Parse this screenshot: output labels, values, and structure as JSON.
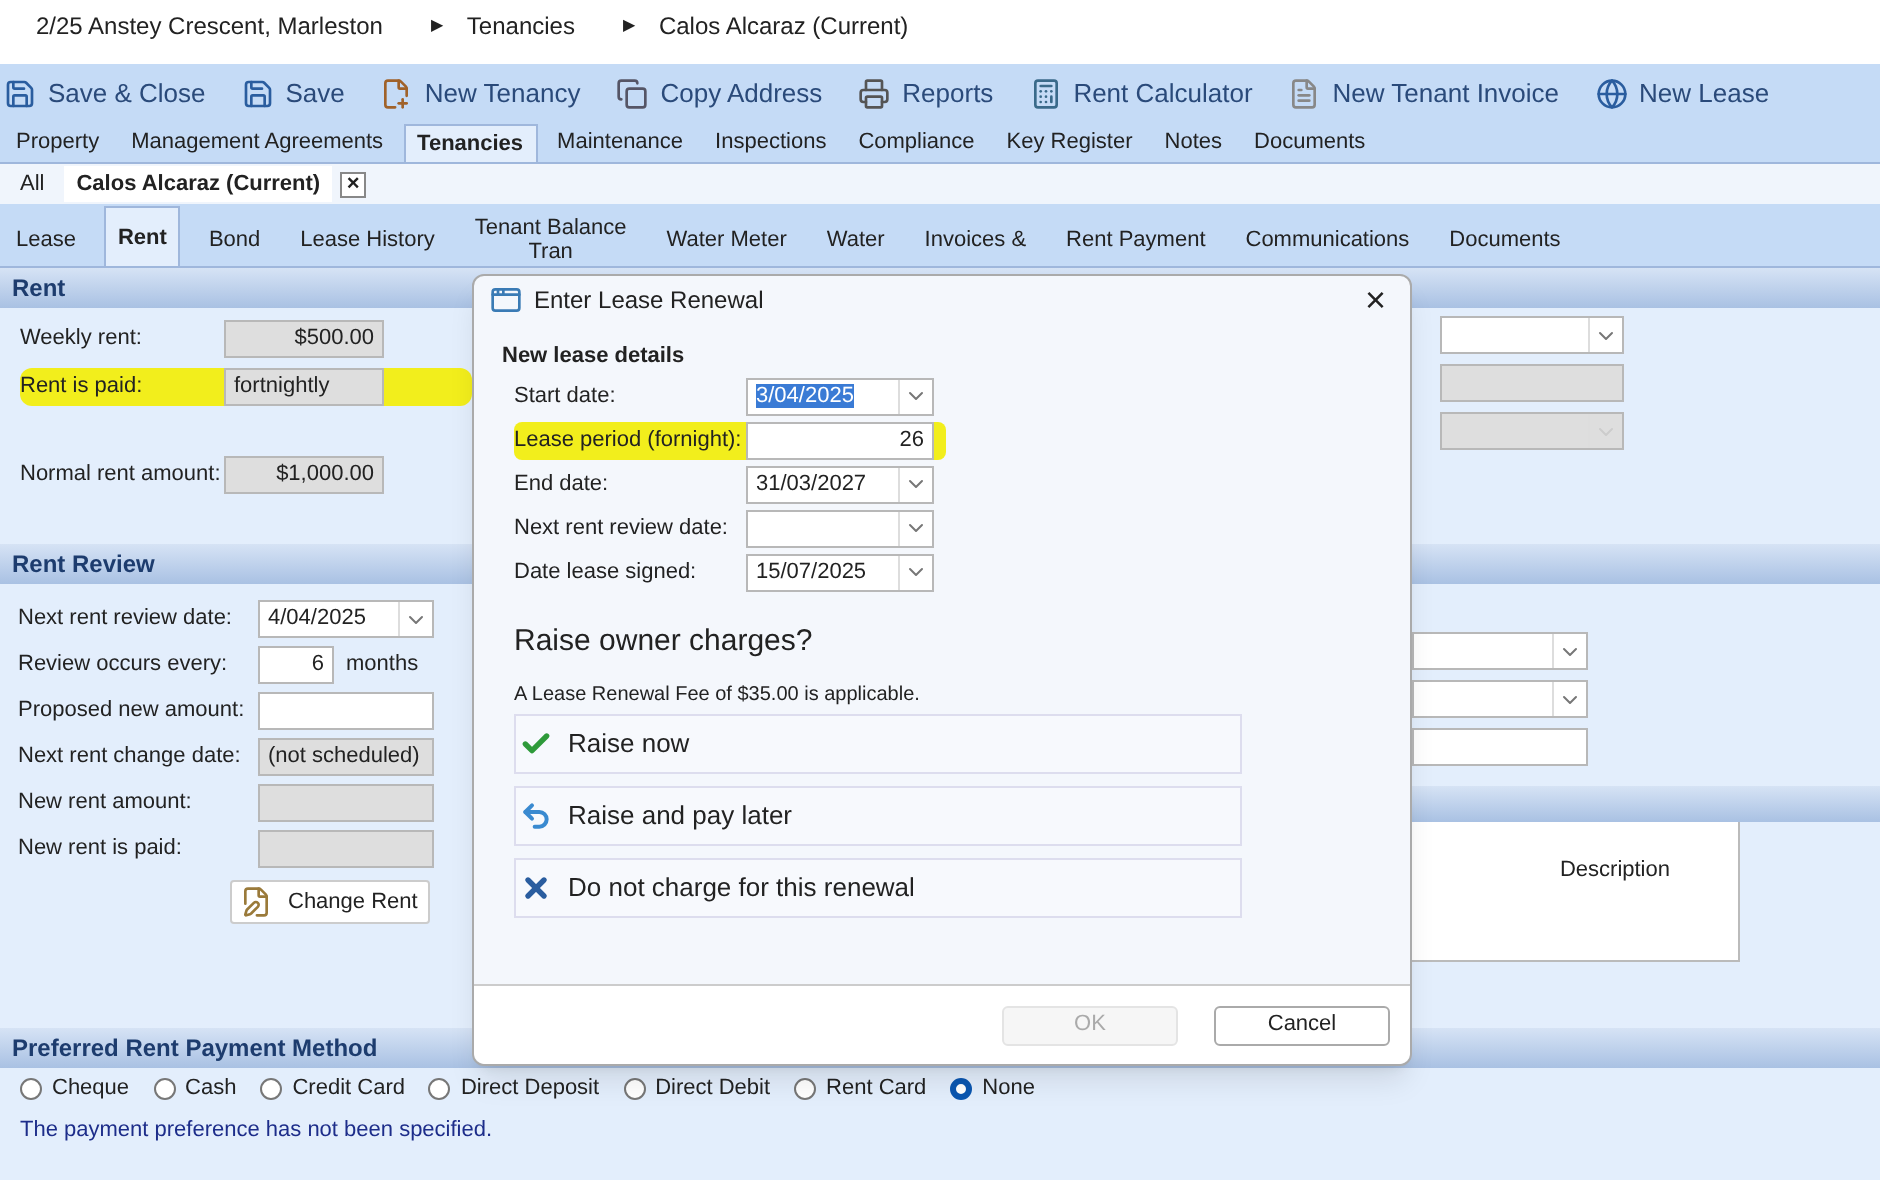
{
  "breadcrumb": [
    "2/25 Anstey Crescent, Marleston",
    "Tenancies",
    "Calos Alcaraz (Current)"
  ],
  "breadcrumb_separator": "▶",
  "toolbar": [
    {
      "label": "Save & Close",
      "kind": "save"
    },
    {
      "label": "Save",
      "kind": "save"
    },
    {
      "label": "New Tenancy",
      "kind": "tenancy"
    },
    {
      "label": "Copy Address",
      "kind": "copy"
    },
    {
      "label": "Reports",
      "kind": "print"
    },
    {
      "label": "Rent Calculator",
      "kind": "calculator"
    },
    {
      "label": "New Tenant Invoice",
      "kind": "invoice"
    },
    {
      "label": "New Lease",
      "kind": "lease"
    }
  ],
  "main_tabs": [
    {
      "label": "Property",
      "selected": false
    },
    {
      "label": "Management Agreements",
      "selected": false
    },
    {
      "label": "Tenancies",
      "selected": true
    },
    {
      "label": "Maintenance",
      "selected": false
    },
    {
      "label": "Inspections",
      "selected": false
    },
    {
      "label": "Compliance",
      "selected": false
    },
    {
      "label": "Key Register",
      "selected": false
    },
    {
      "label": "Notes",
      "selected": false
    },
    {
      "label": "Documents",
      "selected": false
    }
  ],
  "tenancy_tabs": [
    {
      "label": "All",
      "selected": false
    },
    {
      "label": "Calos Alcaraz (Current)",
      "selected": true
    }
  ],
  "close_tab": "×",
  "sub_tabs": [
    {
      "lines": [
        "Lease"
      ],
      "selected": false
    },
    {
      "lines": [
        "Rent"
      ],
      "selected": true
    },
    {
      "lines": [
        "Bond"
      ],
      "selected": false
    },
    {
      "lines": [
        "Lease History"
      ],
      "selected": false
    },
    {
      "lines": [
        "Tenant Balance",
        "Tran"
      ],
      "selected": false
    },
    {
      "lines": [
        "Water Meter"
      ],
      "selected": false
    },
    {
      "lines": [
        "Water"
      ],
      "selected": false
    },
    {
      "lines": [
        "Invoices &"
      ],
      "selected": false
    },
    {
      "lines": [
        "Rent Payment"
      ],
      "selected": false
    },
    {
      "lines": [
        "Communications"
      ],
      "selected": false
    },
    {
      "lines": [
        "Documents"
      ],
      "selected": false
    }
  ],
  "rent": {
    "title": "Rent",
    "fields": [
      {
        "label": "Weekly rent:",
        "value": "$500.00",
        "kind": "amount",
        "highlighted": false
      },
      {
        "label": "Rent is paid:",
        "value": "fortnightly",
        "kind": "text",
        "highlighted": true
      },
      {
        "label": "Normal rent amount:",
        "value": "$1,000.00",
        "kind": "amount",
        "highlighted": false
      }
    ],
    "right_fields": [
      {
        "kind": "dropdown",
        "disabled": false
      },
      {
        "kind": "text",
        "disabled": true
      },
      {
        "kind": "dropdown",
        "disabled": true
      }
    ]
  },
  "rent_review": {
    "title": "Rent Review",
    "fields": [
      {
        "label": "Next rent review date:",
        "value": "4/04/2025",
        "kind": "dropdown",
        "disabled": false
      },
      {
        "label": "Review occurs every:",
        "value": "6",
        "kind": "number",
        "unit": "months",
        "disabled": false
      },
      {
        "label": "Proposed new amount:",
        "kind": "text",
        "disabled": false
      },
      {
        "label": "Next rent change date:",
        "value": "(not scheduled)",
        "kind": "text",
        "disabled": true
      },
      {
        "label": "New rent amount:",
        "kind": "text",
        "disabled": true
      },
      {
        "label": "New rent is paid:",
        "kind": "text",
        "disabled": true
      }
    ],
    "button": "Change Rent",
    "right_fields": [
      {
        "kind": "dropdown"
      },
      {
        "kind": "dropdown"
      },
      {
        "kind": "text"
      }
    ],
    "table_column": "Description"
  },
  "payment": {
    "title": "Preferred Rent Payment Method",
    "options": [
      {
        "label": "Cheque",
        "selected": false
      },
      {
        "label": "Cash",
        "selected": false
      },
      {
        "label": "Credit Card",
        "selected": false
      },
      {
        "label": "Direct Deposit",
        "selected": false
      },
      {
        "label": "Direct Debit",
        "selected": false
      },
      {
        "label": "Rent Card",
        "selected": false
      },
      {
        "label": "None",
        "selected": true
      }
    ],
    "message": "The payment preference has not been specified."
  },
  "dialog": {
    "title": "Enter Lease Renewal",
    "close": "×",
    "section": "New lease details",
    "fields": [
      {
        "label": "Start date:",
        "value": "3/04/2025",
        "kind": "dropdown",
        "text_selected": true,
        "highlighted": false
      },
      {
        "label": "Lease period (fornight):",
        "value": "26",
        "kind": "number",
        "text_selected": false,
        "highlighted": true
      },
      {
        "label": "End date:",
        "value": "31/03/2027",
        "kind": "dropdown",
        "text_selected": false,
        "highlighted": false
      },
      {
        "label": "Next rent review date:",
        "kind": "dropdown",
        "highlighted": false
      },
      {
        "label": "Date lease signed:",
        "value": "15/07/2025",
        "kind": "dropdown",
        "text_selected": false,
        "highlighted": false
      }
    ],
    "question": "Raise owner charges?",
    "fee_note": "A Lease Renewal Fee of $35.00 is applicable.",
    "options": [
      {
        "label": "Raise now",
        "kind": "check"
      },
      {
        "label": "Raise and pay later",
        "kind": "undo"
      },
      {
        "label": "Do not charge for this renewal",
        "kind": "cross"
      }
    ],
    "buttons": [
      {
        "label": "OK",
        "disabled": true
      },
      {
        "label": "Cancel",
        "disabled": false
      }
    ]
  }
}
